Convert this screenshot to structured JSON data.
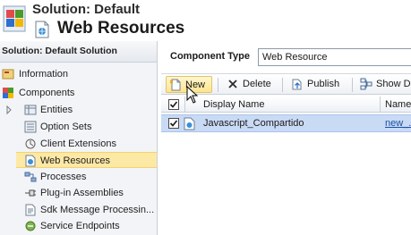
{
  "header": {
    "solution_title": "Solution: Default",
    "page_title": "Web Resources"
  },
  "nav": {
    "header": "Solution: Default Solution",
    "items": [
      {
        "label": "Information",
        "icon": "info-icon"
      },
      {
        "label": "Components",
        "icon": "components-icon"
      },
      {
        "label": "Entities",
        "icon": "entities-icon"
      },
      {
        "label": "Option Sets",
        "icon": "option-sets-icon"
      },
      {
        "label": "Client Extensions",
        "icon": "client-extensions-icon"
      },
      {
        "label": "Web Resources",
        "icon": "web-resource-icon",
        "selected": true
      },
      {
        "label": "Processes",
        "icon": "processes-icon"
      },
      {
        "label": "Plug-in Assemblies",
        "icon": "plugin-icon"
      },
      {
        "label": "Sdk Message Processin...",
        "icon": "sdk-icon"
      },
      {
        "label": "Service Endpoints",
        "icon": "service-endpoint-icon"
      }
    ]
  },
  "main": {
    "component_type_label": "Component Type",
    "component_type_value": "Web Resource",
    "toolbar": {
      "new": "New",
      "delete": "Delete",
      "publish": "Publish",
      "show_dependencies": "Show D"
    },
    "columns": [
      "Display Name",
      "Name"
    ],
    "rows": [
      {
        "display_name": "Javascript_Compartido",
        "name": "new_..."
      }
    ]
  },
  "colors": {
    "selected_nav": "#fde9a6",
    "selected_row": "#c9daf5",
    "link": "#1a4fa0"
  }
}
